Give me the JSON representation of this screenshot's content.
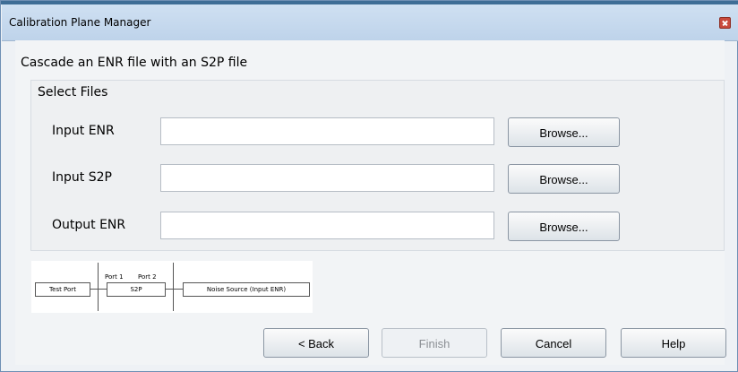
{
  "window": {
    "title": "Calibration Plane Manager"
  },
  "content": {
    "heading": "Cascade an ENR file with an S2P file"
  },
  "group": {
    "title": "Select Files",
    "rows": [
      {
        "label": "Input ENR",
        "value": "",
        "browse": "Browse..."
      },
      {
        "label": "Input S2P",
        "value": "",
        "browse": "Browse..."
      },
      {
        "label": "Output ENR",
        "value": "",
        "browse": "Browse..."
      }
    ]
  },
  "diagram": {
    "test_port": "Test Port",
    "port1": "Port 1",
    "port2": "Port 2",
    "s2p": "S2P",
    "noise_source": "Noise Source (Input ENR)"
  },
  "footer": {
    "back": "< Back",
    "finish": "Finish",
    "cancel": "Cancel",
    "help": "Help"
  }
}
